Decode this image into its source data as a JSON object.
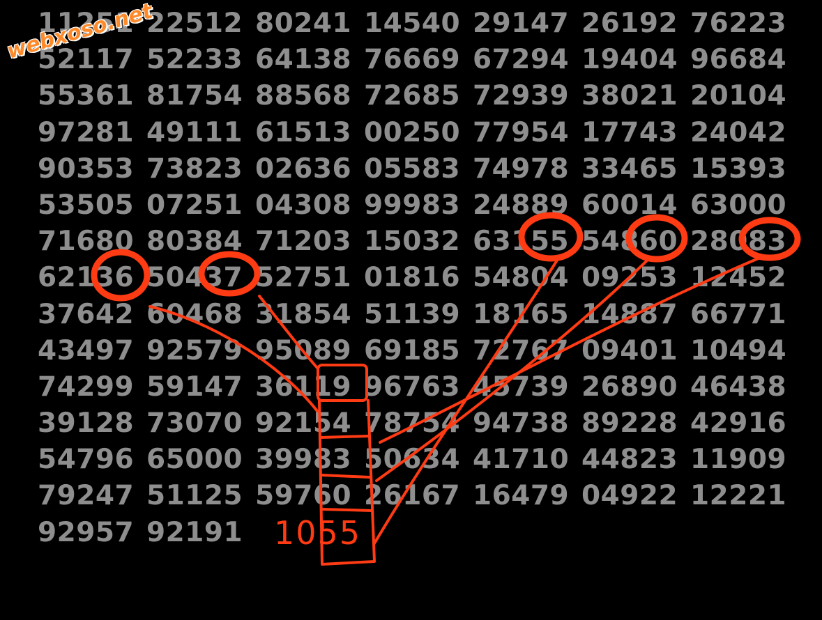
{
  "watermark": "webxoso.net",
  "grid": [
    [
      "11251",
      "22512",
      "80241",
      "14540",
      "29147",
      "26192",
      "76223"
    ],
    [
      "52117",
      "52233",
      "64138",
      "76669",
      "67294",
      "19404",
      "96684"
    ],
    [
      "55361",
      "81754",
      "88568",
      "72685",
      "72939",
      "38021",
      "20104"
    ],
    [
      "97281",
      "49111",
      "61513",
      "00250",
      "77954",
      "17743",
      "24042"
    ],
    [
      "90353",
      "73823",
      "02636",
      "05583",
      "74978",
      "33465",
      "15393"
    ],
    [
      "53505",
      "07251",
      "04308",
      "99983",
      "24889",
      "60014",
      "63000"
    ],
    [
      "71680",
      "80384",
      "71203",
      "15032",
      "63155",
      "54860",
      "28083"
    ],
    [
      "62136",
      "50437",
      "52751",
      "01816",
      "54804",
      "09253",
      "12452"
    ],
    [
      "37642",
      "60468",
      "31854",
      "51139",
      "18165",
      "14887",
      "66771"
    ],
    [
      "43497",
      "92579",
      "95089",
      "69185",
      "72767",
      "09401",
      "10494"
    ],
    [
      "74299",
      "59147",
      "36119",
      "96763",
      "45739",
      "26890",
      "46438"
    ],
    [
      "39128",
      "73070",
      "92154",
      "78754",
      "94738",
      "89228",
      "42916"
    ],
    [
      "54796",
      "65000",
      "39983",
      "50634",
      "41710",
      "44823",
      "11909"
    ],
    [
      "79247",
      "51125",
      "59760",
      "26167",
      "16479",
      "04922",
      "12221"
    ],
    [
      "92957",
      "92191",
      "",
      "",
      "",
      "",
      ""
    ]
  ],
  "annotation": {
    "result_text": "1055",
    "color": "#ff3b14"
  }
}
